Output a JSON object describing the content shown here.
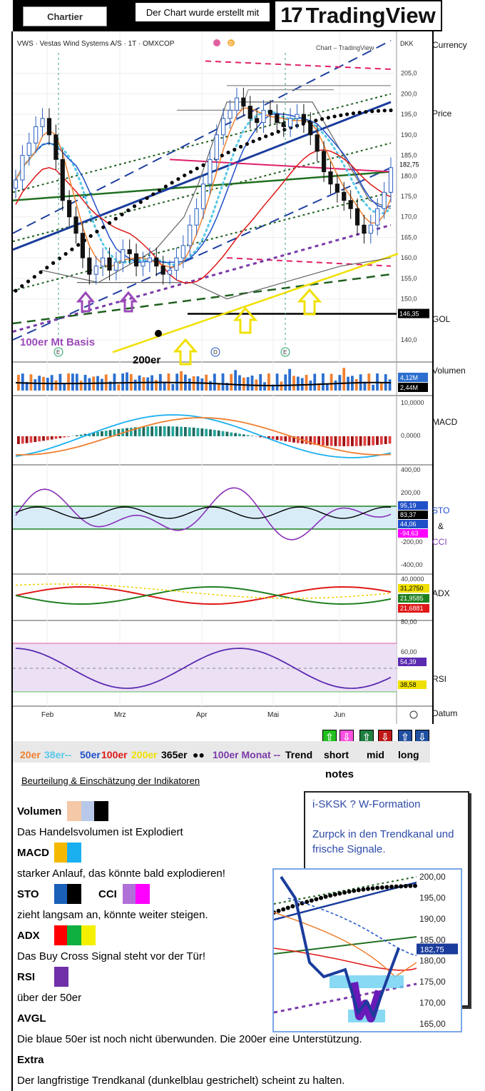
{
  "header": {
    "chartier": "Chartier",
    "made_with": "Der Chart wurde erstellt mit",
    "tradingview": "TradingView"
  },
  "chart_info": {
    "symbol_line": "VWS · Vestas Wind Systems A/S · 1T · OMXCOP",
    "watermark": "Chart – TradingView",
    "currency": "DKK"
  },
  "right_labels": {
    "currency": "Currency",
    "price": "Price",
    "gol": "GOL",
    "volumen": "Volumen",
    "macd": "MACD",
    "sto": "STO",
    "amp": "&",
    "cci": "CCI",
    "adx": "ADX",
    "rsi": "RSI",
    "datum": "Datum"
  },
  "annotations": {
    "basis100": "100er Mt Basis",
    "l200": "200er"
  },
  "chart_data": [
    {
      "type": "line",
      "name": "price",
      "x": [
        "Feb",
        "Mrz",
        "Apr",
        "Mai",
        "Jun"
      ],
      "yticks": [
        "205,0",
        "200,0",
        "195,0",
        "190,0",
        "185,0",
        "180,0",
        "175,0",
        "170,0",
        "165,0",
        "160,0",
        "155,0",
        "150,0",
        "140,0"
      ],
      "ylim": [
        136,
        210
      ],
      "price_labels": [
        "182,75",
        "146,35"
      ],
      "closes": [
        179,
        185,
        188,
        192,
        194,
        190,
        184,
        174,
        170,
        166,
        160,
        156,
        158,
        160,
        157,
        159,
        162,
        161,
        158,
        159,
        160,
        158,
        156,
        157,
        160,
        163,
        168,
        172,
        178,
        184,
        190,
        194,
        196,
        199,
        197,
        194,
        193,
        196,
        195,
        193,
        192,
        194,
        195,
        193,
        190,
        186,
        181,
        178,
        176,
        174,
        172,
        168,
        166,
        168,
        172,
        176,
        182
      ]
    },
    {
      "type": "bar",
      "name": "volume",
      "labels": [
        "4,12M",
        "2,44M"
      ]
    },
    {
      "type": "bar",
      "name": "macd",
      "yticks": [
        "10,0000",
        "0,0000"
      ]
    },
    {
      "type": "line",
      "name": "sto_cci",
      "yticks": [
        "400,00",
        "200,00",
        "-200,00",
        "-400,00"
      ],
      "labels": [
        "95,19",
        "83,37",
        "44,06",
        "-94,63"
      ]
    },
    {
      "type": "line",
      "name": "adx",
      "yticks": [
        "40,0000"
      ],
      "labels": [
        "31,2750",
        "21,9585",
        "21,6881"
      ]
    },
    {
      "type": "line",
      "name": "rsi",
      "yticks": [
        "80,00",
        "60,00"
      ],
      "labels": [
        "54,39",
        "38,58"
      ]
    }
  ],
  "legend": {
    "l20": "20er",
    "l38": "38er--",
    "l50": "50er",
    "l100": "100er",
    "l200": "200er",
    "l365": "365er",
    "dots": "●●",
    "l100m": "100er Monat --",
    "trend": "Trend",
    "short": "short",
    "mid": "mid",
    "long": "long",
    "notes": "notes"
  },
  "colors": {
    "l20": "#f08030",
    "l38": "#58c8e8",
    "l50": "#2050c8",
    "l100": "#e01818",
    "l200": "#f0e000",
    "l365": "#000000",
    "l100m": "#7a3aa8"
  },
  "assessment": {
    "title": "Beurteilung & Einschätzung der Indikatoren",
    "items": [
      {
        "name": "Volumen",
        "text": "Das Handelsvolumen ist Explodiert"
      },
      {
        "name": "MACD",
        "text": "starker Anlauf, das könnte bald explodieren!"
      },
      {
        "name": "STO",
        "name2": "CCI",
        "text": "zieht langsam an, könnte weiter steigen."
      },
      {
        "name": "ADX",
        "text": "Das Buy Cross Signal steht vor der Tür!"
      },
      {
        "name": "RSI",
        "text": "über der 50er"
      },
      {
        "name": "AVGL",
        "text": "Die blaue 50er ist noch nicht überwunden. Die 200er eine Unterstützung."
      },
      {
        "name": "Extra",
        "text": "Der langfristige Trendkanal (dunkelblau gestrichelt) scheint zu halten."
      }
    ]
  },
  "note_box": {
    "title": "i-SKSK ? W-Formation",
    "body": "Zurpck in den Trendkanal und frische Signale."
  },
  "zoom_chart": {
    "yticks": [
      "200,00",
      "195,00",
      "190,00",
      "185,00",
      "180,00",
      "175,00",
      "170,00",
      "165,00"
    ],
    "price_label": "182,75"
  }
}
